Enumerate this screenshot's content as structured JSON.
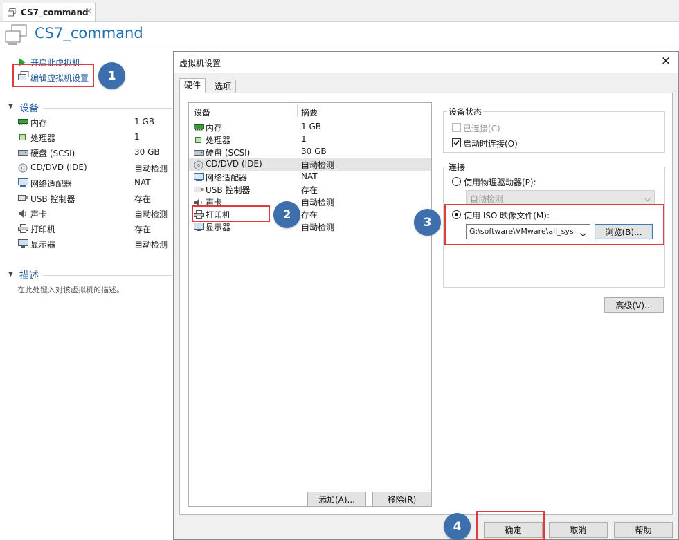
{
  "tab": {
    "label": "CS7_command",
    "close_glyph": "×"
  },
  "header": {
    "title": "CS7_command"
  },
  "left_panel": {
    "actions": [
      {
        "label": "开启此虚拟机",
        "icon": "play-icon"
      },
      {
        "label": "编辑虚拟机设置",
        "icon": "vm-settings-icon"
      }
    ],
    "devices_section": {
      "title": "设备",
      "collapse_glyph": "▼"
    },
    "devices": [
      {
        "name": "内存",
        "value": "1 GB",
        "icon": "memory-icon"
      },
      {
        "name": "处理器",
        "value": "1",
        "icon": "processor-icon"
      },
      {
        "name": "硬盘 (SCSI)",
        "value": "30 GB",
        "icon": "harddisk-icon"
      },
      {
        "name": "CD/DVD (IDE)",
        "value": "自动检测",
        "icon": "cd-dvd-icon"
      },
      {
        "name": "网络适配器",
        "value": "NAT",
        "icon": "network-adapter-icon"
      },
      {
        "name": "USB 控制器",
        "value": "存在",
        "icon": "usb-icon"
      },
      {
        "name": "声卡",
        "value": "自动检测",
        "icon": "sound-card-icon"
      },
      {
        "name": "打印机",
        "value": "存在",
        "icon": "printer-icon"
      },
      {
        "name": "显示器",
        "value": "自动检测",
        "icon": "display-icon"
      }
    ],
    "description_section": {
      "title": "描述",
      "collapse_glyph": "▼",
      "placeholder": "在此处键入对该虚拟机的描述。"
    }
  },
  "annotations": {
    "b1": "1",
    "b2": "2",
    "b3": "3",
    "b4": "4"
  },
  "dialog": {
    "title": "虚拟机设置",
    "close_glyph": "✕",
    "tabs": [
      "硬件",
      "选项"
    ],
    "columns": {
      "device": "设备",
      "summary": "摘要"
    },
    "hardware": [
      {
        "name": "内存",
        "summary": "1 GB",
        "icon": "memory-icon"
      },
      {
        "name": "处理器",
        "summary": "1",
        "icon": "processor-icon"
      },
      {
        "name": "硬盘 (SCSI)",
        "summary": "30 GB",
        "icon": "harddisk-icon"
      },
      {
        "name": "CD/DVD (IDE)",
        "summary": "自动检测",
        "icon": "cd-dvd-icon",
        "selected": true
      },
      {
        "name": "网络适配器",
        "summary": "NAT",
        "icon": "network-adapter-icon"
      },
      {
        "name": "USB 控制器",
        "summary": "存在",
        "icon": "usb-icon"
      },
      {
        "name": "声卡",
        "summary": "自动检测",
        "icon": "sound-card-icon"
      },
      {
        "name": "打印机",
        "summary": "存在",
        "icon": "printer-icon"
      },
      {
        "name": "显示器",
        "summary": "自动检测",
        "icon": "display-icon"
      }
    ],
    "add_button": "添加(A)...",
    "remove_button": "移除(R)",
    "device_status": {
      "title": "设备状态",
      "connected": {
        "label": "已连接(C)",
        "checked": false,
        "enabled": false
      },
      "connect_on_power_on": {
        "label": "启动时连接(O)",
        "checked": true
      }
    },
    "connection": {
      "title": "连接",
      "physical_drive": {
        "label": "使用物理驱动器(P):",
        "selected": false
      },
      "physical_drive_value": "自动检测",
      "iso_image": {
        "label": "使用 ISO 映像文件(M):",
        "selected": true
      },
      "iso_path": "G:\\software\\VMware\\all_sys",
      "browse_button": "浏览(B)..."
    },
    "advanced_button": "高级(V)...",
    "footer": {
      "ok": "确定",
      "cancel": "取消",
      "help": "帮助"
    }
  },
  "colors": {
    "accent_blue": "#1f6fb5",
    "bubble_blue": "#3d6fad",
    "annotation_red": "#e23b3b"
  }
}
